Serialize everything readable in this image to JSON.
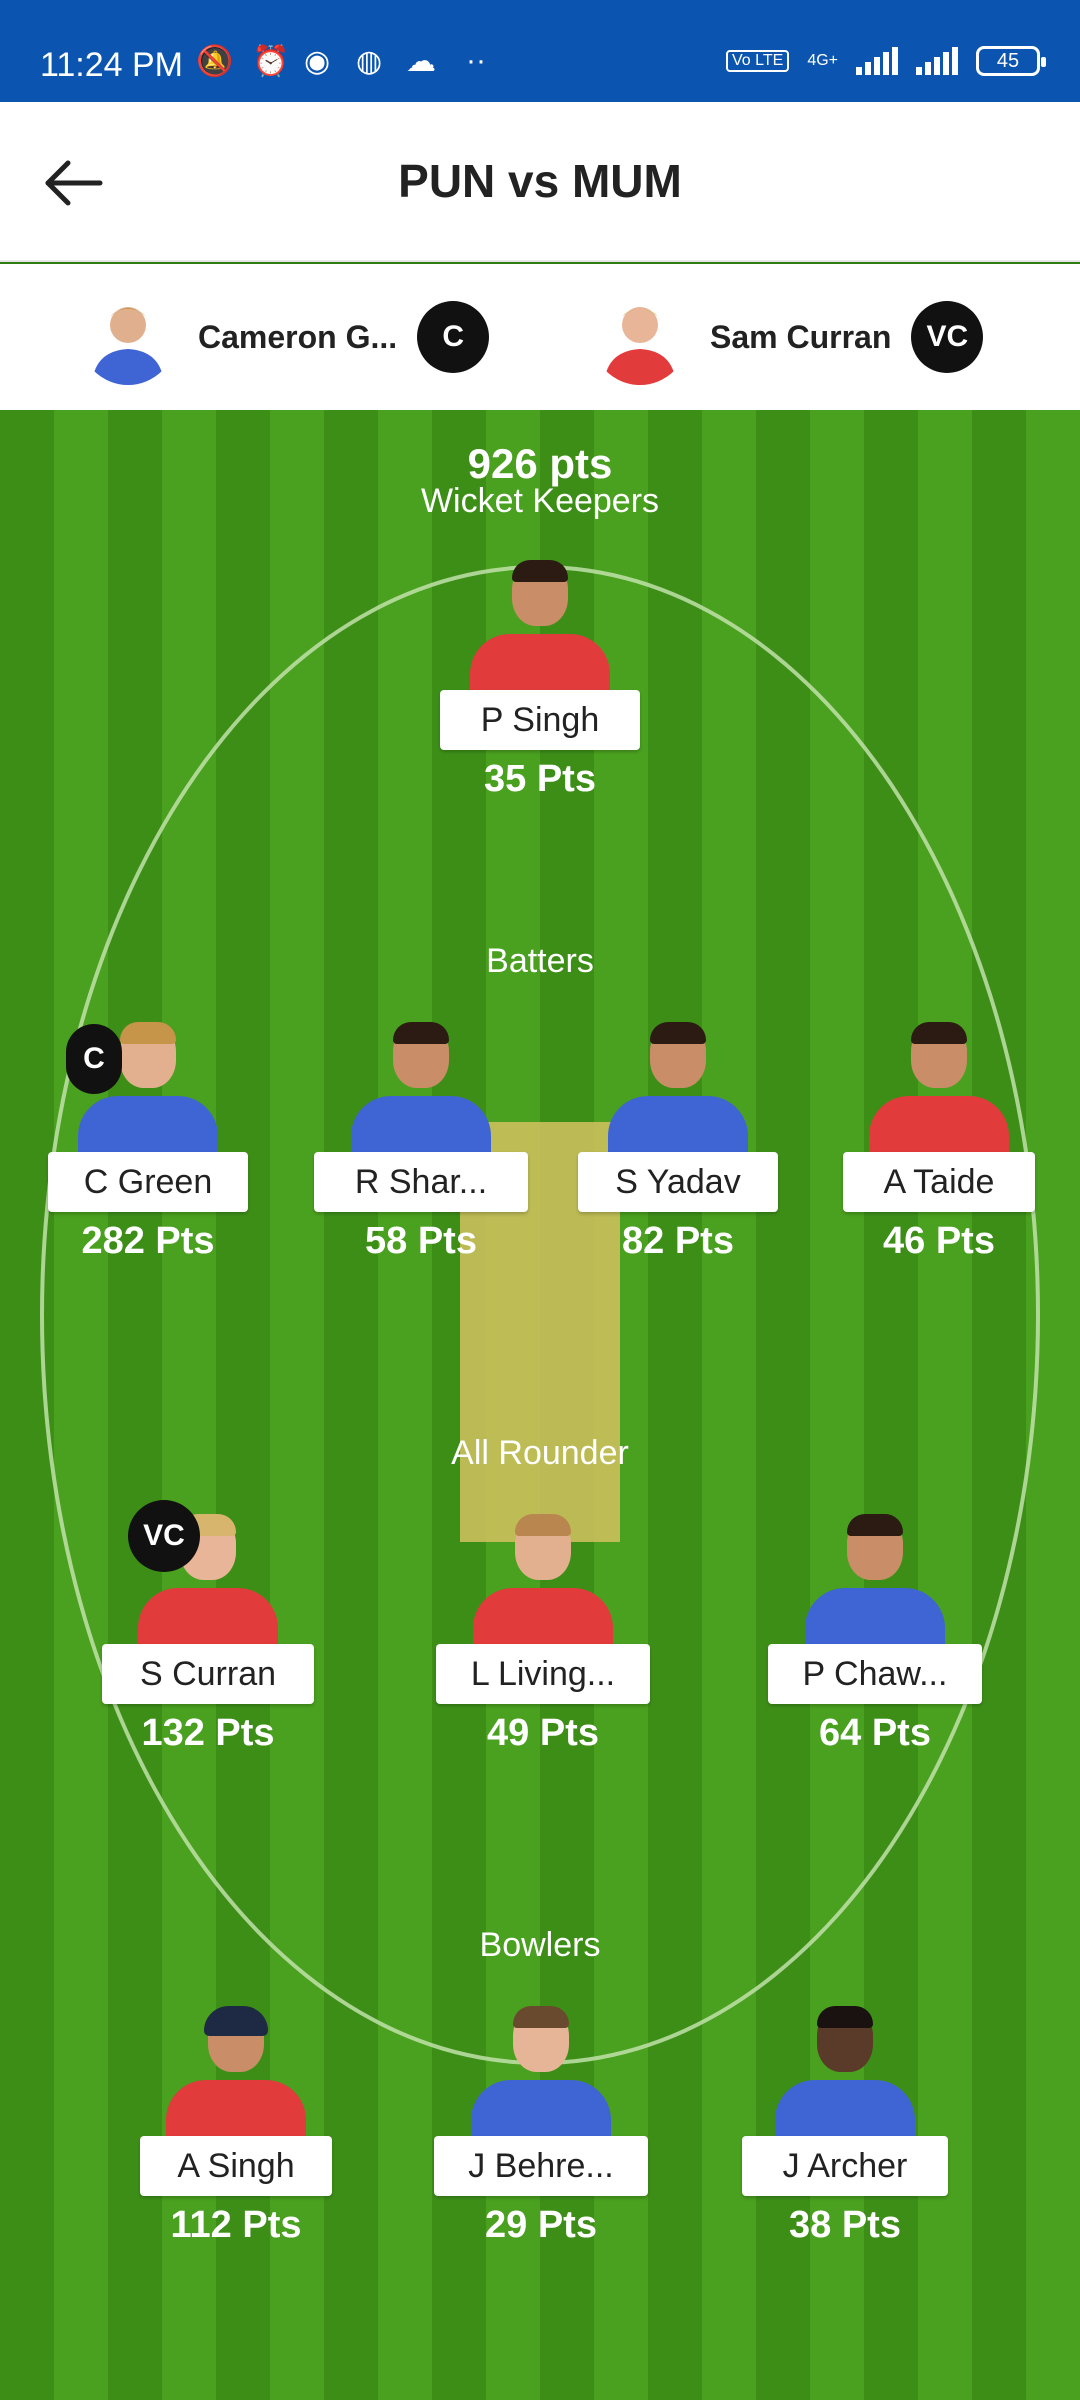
{
  "status": {
    "time": "11:24 PM",
    "network": "4G+",
    "volte": "Vo LTE",
    "battery": "45"
  },
  "header": {
    "title": "PUN vs MUM"
  },
  "captains": {
    "captain": {
      "name": "Cameron G...",
      "badge": "C"
    },
    "vice_captain": {
      "name": "Sam Curran",
      "badge": "VC"
    }
  },
  "team": {
    "total_points": "926 pts",
    "sections": {
      "wicket_keepers": "Wicket Keepers",
      "batters": "Batters",
      "all_rounder": "All Rounder",
      "bowlers": "Bowlers"
    },
    "players": {
      "wk1": {
        "name": "P Singh",
        "points": "35 Pts",
        "team_color": "red"
      },
      "bat1": {
        "name": "C Green",
        "points": "282 Pts",
        "team_color": "blue",
        "badge": "C"
      },
      "bat2": {
        "name": "R Shar...",
        "points": "58 Pts",
        "team_color": "blue"
      },
      "bat3": {
        "name": "S Yadav",
        "points": "82 Pts",
        "team_color": "blue"
      },
      "bat4": {
        "name": "A Taide",
        "points": "46 Pts",
        "team_color": "red"
      },
      "ar1": {
        "name": "S Curran",
        "points": "132 Pts",
        "team_color": "red",
        "badge": "VC"
      },
      "ar2": {
        "name": "L Living...",
        "points": "49 Pts",
        "team_color": "red"
      },
      "ar3": {
        "name": "P Chaw...",
        "points": "64 Pts",
        "team_color": "blue"
      },
      "bowl1": {
        "name": "A Singh",
        "points": "112 Pts",
        "team_color": "red"
      },
      "bowl2": {
        "name": "J Behre...",
        "points": "29 Pts",
        "team_color": "blue"
      },
      "bowl3": {
        "name": "J Archer",
        "points": "38 Pts",
        "team_color": "blue"
      }
    }
  },
  "colors": {
    "status_bar": "#0b55b0",
    "field_dark": "#3d8e17",
    "field_light": "#4aa01f",
    "pitch": "#c7be5a",
    "badge": "#111111"
  }
}
